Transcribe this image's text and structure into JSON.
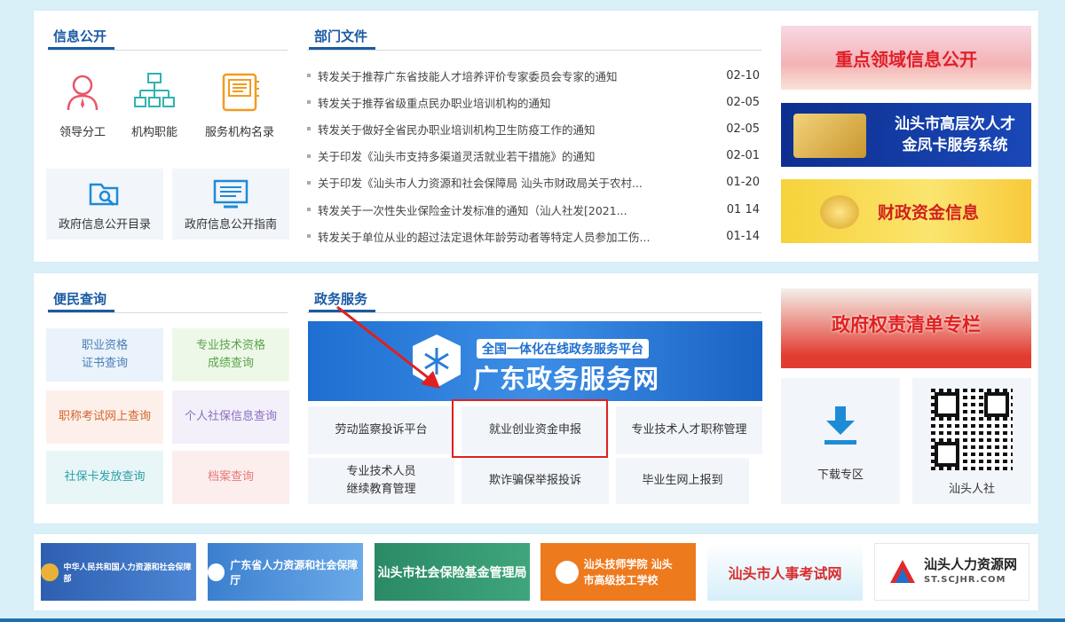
{
  "info": {
    "title": "信息公开",
    "icons": [
      {
        "label": "领导分工",
        "icon": "person-icon"
      },
      {
        "label": "机构职能",
        "icon": "org-chart-icon"
      },
      {
        "label": "服务机构名录",
        "icon": "book-icon"
      }
    ],
    "boxes": [
      {
        "label": "政府信息公开目录",
        "icon": "search-folder-icon"
      },
      {
        "label": "政府信息公开指南",
        "icon": "monitor-icon"
      }
    ]
  },
  "docs": {
    "title": "部门文件",
    "items": [
      {
        "title": "转发关于推荐广东省技能人才培养评价专家委员会专家的通知",
        "date": "02-10"
      },
      {
        "title": "转发关于推荐省级重点民办职业培训机构的通知",
        "date": "02-05"
      },
      {
        "title": "转发关于做好全省民办职业培训机构卫生防疫工作的通知",
        "date": "02-05"
      },
      {
        "title": "关于印发《汕头市支持多渠道灵活就业若干措施》的通知",
        "date": "02-01"
      },
      {
        "title": "关于印发《汕头市人力资源和社会保障局 汕头市财政局关于农村...",
        "date": "01-20"
      },
      {
        "title": "转发关于一次性失业保险金计发标准的通知（汕人社发[2021...",
        "date": "01 14"
      },
      {
        "title": "转发关于单位从业的超过法定退休年龄劳动者等特定人员参加工伤...",
        "date": "01-14"
      }
    ]
  },
  "banners": {
    "b1": "重点领域信息公开",
    "b2_line1": "汕头市高层次人才",
    "b2_line2": "金凤卡服务系统",
    "b3": "财政资金信息",
    "b4": "政府权责清单专栏"
  },
  "query": {
    "title": "便民查询",
    "items": [
      {
        "line1": "职业资格",
        "line2": "证书查询",
        "color": "#4a7fb5",
        "bg": "#eaf2fb"
      },
      {
        "line1": "专业技术资格",
        "line2": "成绩查询",
        "color": "#5aa34a",
        "bg": "#eef8e8"
      },
      {
        "line1": "职称考试网上查询",
        "line2": "",
        "color": "#d2662e",
        "bg": "#fdf0ea"
      },
      {
        "line1": "个人社保信息查询",
        "line2": "",
        "color": "#8a6fbf",
        "bg": "#f3f0fa"
      },
      {
        "line1": "社保卡发放查询",
        "line2": "",
        "color": "#2e9fa8",
        "bg": "#e8f6f7"
      },
      {
        "line1": "档案查询",
        "line2": "",
        "color": "#e57b7b",
        "bg": "#fdeeee"
      }
    ]
  },
  "services": {
    "title": "政务服务",
    "banner_small": "全国一体化在线政务服务平台",
    "banner_big": "广东政务服务网",
    "row1": [
      "劳动监察投诉平台",
      "就业创业资金申报",
      "专业技术人才职称管理"
    ],
    "row2_a_line1": "专业技术人员",
    "row2_a_line2": "继续教育管理",
    "row2": [
      "欺诈骗保举报投诉",
      "毕业生网上报到"
    ]
  },
  "side": {
    "download": "下载专区",
    "qr": "汕头人社"
  },
  "links": [
    {
      "text": "中华人民共和国人力资源和社会保障部",
      "bg": "#3b6ec0",
      "color": "#ffffff"
    },
    {
      "text": "广东省人力资源和社会保障厅",
      "bg": "#4a8fd6",
      "color": "#ffffff"
    },
    {
      "text": "汕头市社会保险基金管理局",
      "bg": "#2f8c6a",
      "color": "#ffffff"
    },
    {
      "text": "汕头技师学院 汕头市高级技工学校",
      "bg": "#ee7a1e",
      "color": "#ffffff"
    },
    {
      "text": "汕头市人事考试网",
      "bg": "#e8f4fb",
      "color": "#d92b2b"
    },
    {
      "text": "汕头人力资源网",
      "sub": "ST.SCJHR.COM",
      "bg": "#ffffff",
      "color": "#222222"
    }
  ],
  "accent": "#1a5aa3"
}
